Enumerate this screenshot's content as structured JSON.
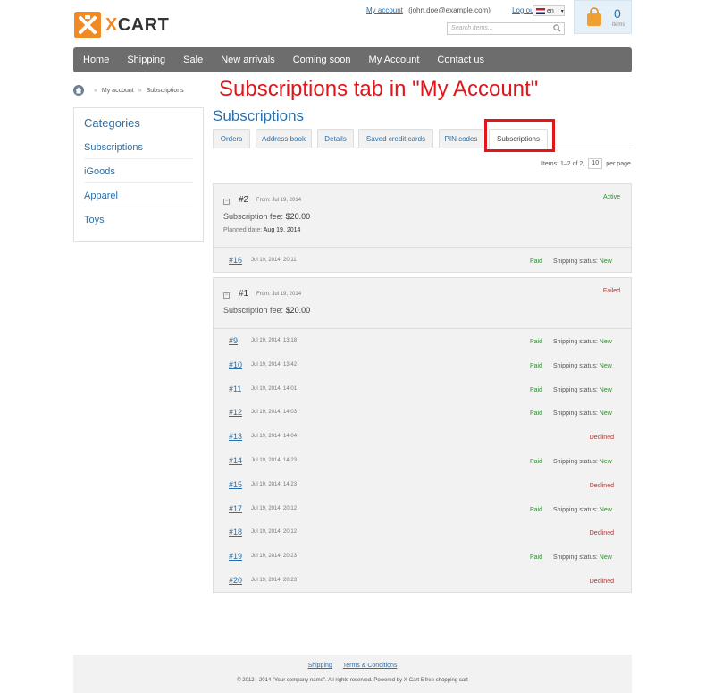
{
  "logo": {
    "text_x": "X",
    "text_rest": "CART"
  },
  "header": {
    "my_account_link": "My account",
    "user_email": "(john.doe@example.com)",
    "logout_link": "Log out",
    "language": "en",
    "search_placeholder": "Search items...",
    "cart_count": "0",
    "cart_items_label": "items"
  },
  "nav": {
    "items": [
      "Home",
      "Shipping",
      "Sale",
      "New arrivals",
      "Coming soon",
      "My Account",
      "Contact us"
    ]
  },
  "breadcrumb": {
    "items": [
      "My account",
      "Subscriptions"
    ]
  },
  "annotation": "Subscriptions tab in \"My Account\"",
  "sidebar": {
    "title": "Categories",
    "items": [
      "Subscriptions",
      "iGoods",
      "Apparel",
      "Toys"
    ]
  },
  "page_title": "Subscriptions",
  "tabs": [
    "Orders",
    "Address book",
    "Details",
    "Saved credit cards",
    "PIN codes",
    "Subscriptions"
  ],
  "pager": {
    "items_text": "Items: 1–2 of 2,",
    "per_page_value": "10",
    "per_page_label": "per page"
  },
  "subscriptions": [
    {
      "number": "#2",
      "from": "From: Jul 19, 2014",
      "status": "Active",
      "fee_label": "Subscription fee:",
      "fee_value": "$20.00",
      "planned_label": "Planned date:",
      "planned_value": "Aug 19, 2014",
      "orders": [
        {
          "num": "#16",
          "date": "Jul 19, 2014, 20:11",
          "paid": "Paid",
          "shipping_label": "Shipping status:",
          "shipping_value": "New",
          "declined": ""
        }
      ]
    },
    {
      "number": "#1",
      "from": "From: Jul 19, 2014",
      "status": "Failed",
      "fee_label": "Subscription fee:",
      "fee_value": "$20.00",
      "orders": [
        {
          "num": "#9",
          "date": "Jul 19, 2014, 13:18",
          "paid": "Paid",
          "shipping_label": "Shipping status:",
          "shipping_value": "New",
          "declined": ""
        },
        {
          "num": "#10",
          "date": "Jul 19, 2014, 13:42",
          "paid": "Paid",
          "shipping_label": "Shipping status:",
          "shipping_value": "New",
          "declined": ""
        },
        {
          "num": "#11",
          "date": "Jul 19, 2014, 14:01",
          "paid": "Paid",
          "shipping_label": "Shipping status:",
          "shipping_value": "New",
          "declined": ""
        },
        {
          "num": "#12",
          "date": "Jul 19, 2014, 14:03",
          "paid": "Paid",
          "shipping_label": "Shipping status:",
          "shipping_value": "New",
          "declined": ""
        },
        {
          "num": "#13",
          "date": "Jul 19, 2014, 14:04",
          "paid": "",
          "shipping_label": "",
          "shipping_value": "",
          "declined": "Declined"
        },
        {
          "num": "#14",
          "date": "Jul 19, 2014, 14:23",
          "paid": "Paid",
          "shipping_label": "Shipping status:",
          "shipping_value": "New",
          "declined": ""
        },
        {
          "num": "#15",
          "date": "Jul 19, 2014, 14:23",
          "paid": "",
          "shipping_label": "",
          "shipping_value": "",
          "declined": "Declined"
        },
        {
          "num": "#17",
          "date": "Jul 19, 2014, 20:12",
          "paid": "Paid",
          "shipping_label": "Shipping status:",
          "shipping_value": "New",
          "declined": ""
        },
        {
          "num": "#18",
          "date": "Jul 19, 2014, 20:12",
          "paid": "",
          "shipping_label": "",
          "shipping_value": "",
          "declined": "Declined"
        },
        {
          "num": "#19",
          "date": "Jul 19, 2014, 20:23",
          "paid": "Paid",
          "shipping_label": "Shipping status:",
          "shipping_value": "New",
          "declined": ""
        },
        {
          "num": "#20",
          "date": "Jul 19, 2014, 20:23",
          "paid": "",
          "shipping_label": "",
          "shipping_value": "",
          "declined": "Declined"
        }
      ]
    }
  ],
  "footer": {
    "links": [
      "Shipping",
      "Terms & Conditions"
    ],
    "copyright": "© 2012 - 2014 \"Your company name\". All rights reserved. Powered by X-Cart 5 free shopping cart"
  },
  "colors": {
    "accent": "#2b6fa8",
    "brand": "#f08a24",
    "nav": "#6d6d6d",
    "annotation": "#e0161b",
    "paid": "#2e8b2e",
    "declined": "#aa3333"
  }
}
